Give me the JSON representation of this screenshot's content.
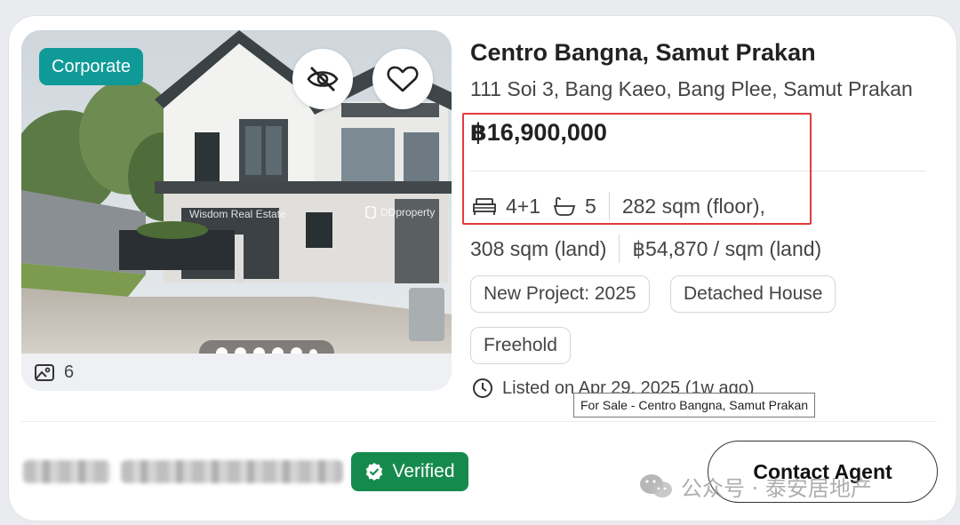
{
  "listing": {
    "badge": "Corporate",
    "photo_count": "6",
    "photo_watermarks": [
      "Wisdom Real Estate",
      "DDproperty"
    ],
    "title": "Centro Bangna, Samut Prakan",
    "address": "111 Soi 3, Bang Kaeo, Bang Plee, Samut Prakan",
    "price": "฿16,900,000",
    "bedrooms": "4+1",
    "bathrooms": "5",
    "floor_area": "282 sqm (floor),",
    "land_area": "308 sqm (land)",
    "price_per_land": "฿54,870 / sqm (land)",
    "tags": [
      "New Project: 2025",
      "Detached House",
      "Freehold"
    ],
    "listed": "Listed on Apr 29, 2025 (1w ago)",
    "tooltip": "For Sale - Centro Bangna, Samut Prakan"
  },
  "carousel": {
    "total": 6,
    "active_index": 0
  },
  "agent": {
    "verified_label": "Verified",
    "contact_label": "Contact Agent"
  },
  "overlay_watermark": "公众号 · 泰安居地产",
  "colors": {
    "badge": "#0f9a97",
    "verified": "#168a4d",
    "highlight": "#e33b3b"
  },
  "icons": [
    "eye-off-icon",
    "heart-icon",
    "gallery-icon",
    "bed-icon",
    "bath-icon",
    "clock-icon",
    "verified-check-icon"
  ]
}
